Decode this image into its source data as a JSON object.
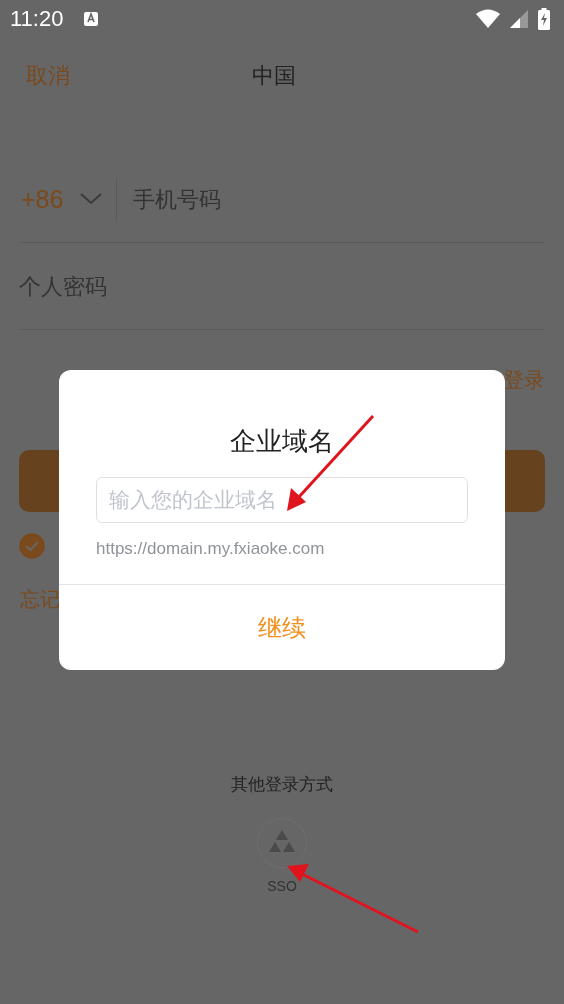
{
  "status_bar": {
    "time": "11:20"
  },
  "header": {
    "cancel": "取消",
    "title": "中国"
  },
  "login_form": {
    "country_code": "+86",
    "phone_placeholder": "手机号码",
    "password_placeholder": "个人密码",
    "alt_login_link": "登录",
    "agreement": {
      "checked": true
    },
    "forgot_password": "忘记"
  },
  "other_login": {
    "label": "其他登录方式",
    "methods": [
      {
        "label": "SSO"
      }
    ]
  },
  "dialog": {
    "title": "企业域名",
    "input_placeholder": "输入您的企业域名",
    "hint": "https://domain.my.fxiaoke.com",
    "button": "继续"
  }
}
